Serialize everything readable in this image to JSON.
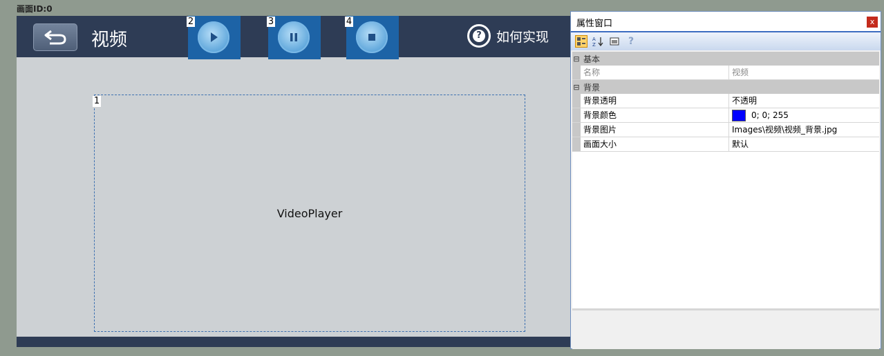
{
  "screen_id": "画面ID:0",
  "canvas": {
    "title": "视频",
    "help_label": "如何实现",
    "help_symbol": "?",
    "controls": [
      {
        "number": "2",
        "icon": "play-icon"
      },
      {
        "number": "3",
        "icon": "pause-icon"
      },
      {
        "number": "4",
        "icon": "stop-icon"
      }
    ],
    "video_number": "1",
    "video_label": "VideoPlayer",
    "colors": {
      "bar": "#2e3c55",
      "control": "#1d63a6"
    }
  },
  "panel": {
    "title": "属性窗口",
    "close": "x",
    "toolbar_icons": [
      "categorized-icon",
      "sort-az-icon",
      "property-pages-icon",
      "help-icon"
    ],
    "categories": [
      {
        "label": "基本",
        "toggle": "⊟",
        "rows": [
          {
            "name": "名称",
            "value": "视频",
            "dim": true
          }
        ]
      },
      {
        "label": "背景",
        "toggle": "⊟",
        "rows": [
          {
            "name": "背景透明",
            "value": "不透明"
          },
          {
            "name": "背景颜色",
            "value": "0; 0; 255",
            "swatch": "#0000ff"
          },
          {
            "name": "背景图片",
            "value": "Images\\视频\\视频_背景.jpg"
          },
          {
            "name": "画面大小",
            "value": "默认"
          }
        ]
      }
    ]
  }
}
